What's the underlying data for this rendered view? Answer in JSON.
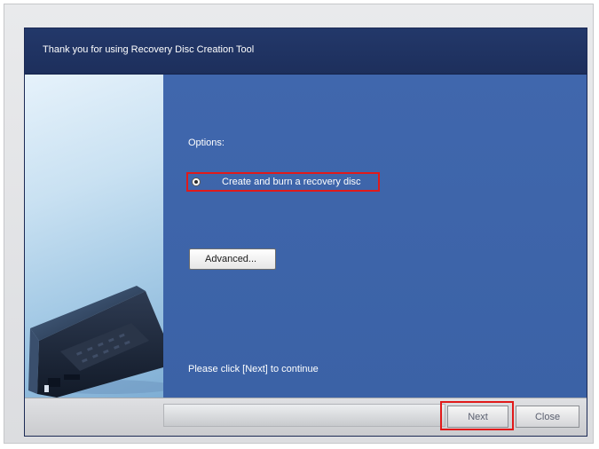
{
  "window": {
    "title": "Thank you for using Recovery Disc Creation Tool"
  },
  "main": {
    "options_label": "Options:",
    "radio_option_label": "Create and burn a recovery disc",
    "advanced_button_label": "Advanced...",
    "instruction": "Please click [Next] to continue"
  },
  "footer": {
    "next_label": "Next",
    "close_label": "Close"
  },
  "colors": {
    "title_bar": "#1d2f5c",
    "content_background": "#3e63a8",
    "highlight_border": "#e11a1a",
    "footer_background": "#d4d5d8"
  }
}
